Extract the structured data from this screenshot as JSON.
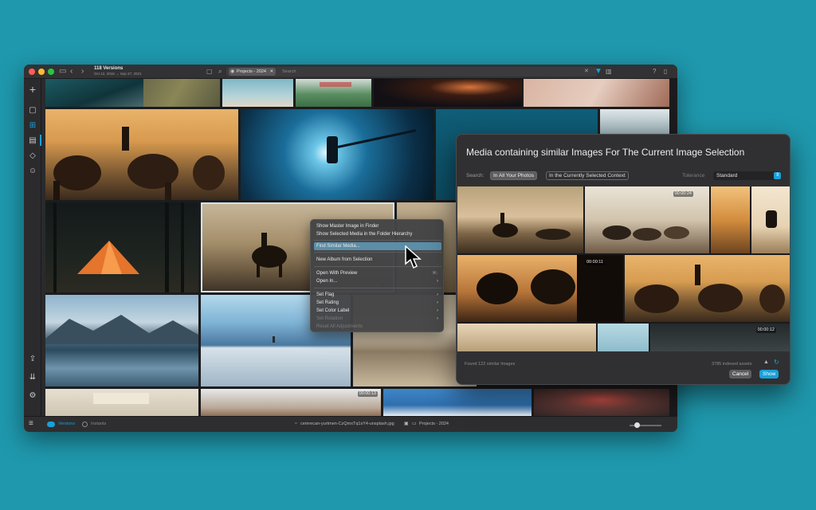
{
  "window": {
    "title": "118 Versions",
    "subtitle": "Oct 12, 2018 → Sep 27, 2021",
    "search_chip": "Projects - 2024",
    "search_placeholder": "Search"
  },
  "context_menu": {
    "items": [
      {
        "label": "Show Master Image in Finder"
      },
      {
        "label": "Show Selected Media in the Folder Hierarchy"
      },
      {
        "label": "Find Similar Media...",
        "highlighted": true
      },
      {
        "label": "New Album from Selection"
      },
      {
        "label": "Open With Preview",
        "shortcut": "⌘↓"
      },
      {
        "label": "Open In...",
        "submenu": true
      },
      {
        "label": "Set Flag",
        "submenu": true
      },
      {
        "label": "Set Rating",
        "submenu": true
      },
      {
        "label": "Set Color Label",
        "submenu": true
      },
      {
        "label": "Set Rotation",
        "submenu": true
      },
      {
        "label": "Reset All Adjustments"
      }
    ]
  },
  "dialog": {
    "title": "Media containing similar Images For The Current Image Selection",
    "search_label": "Search:",
    "scope_options": [
      "In All Your Photos",
      "In the Currently Selected Context"
    ],
    "scope_selected": "In All Your Photos",
    "tolerance_label": "Tolerance",
    "tolerance_value": "Standard",
    "durations": [
      "00:00:24",
      "00:00:11",
      "00:00:12"
    ],
    "found_text": "Found 122 similar Images",
    "indexed_text": "3785 indexed assets",
    "cancel_label": "Cancel",
    "show_label": "Show"
  },
  "grid": {
    "video_duration": "00:00:13"
  },
  "bottombar": {
    "versions_label": "Versions",
    "instants_label": "Instants",
    "filename": "cemrecan-yurtmen-CzQmxTq1sY4-unsplash.jpg",
    "folder": "Projects - 2024"
  },
  "colors": {
    "background": "#1f98ad",
    "accent": "#1aa0d8",
    "menu_highlight": "#5b8ea8"
  }
}
